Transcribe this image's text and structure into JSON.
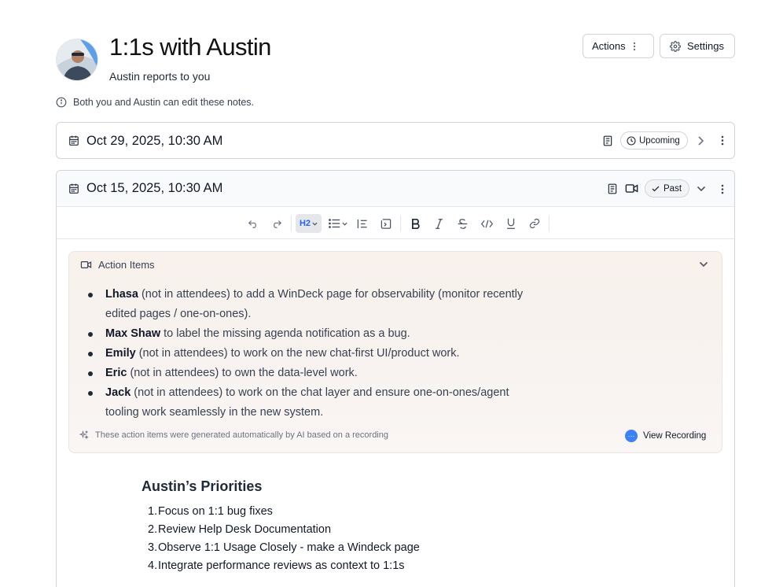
{
  "header": {
    "title": "1:1s with Austin",
    "subtitle": "Austin reports to you",
    "actions_label": "Actions",
    "settings_label": "Settings"
  },
  "info": {
    "text": "Both you and Austin can edit these notes."
  },
  "meetings": [
    {
      "date": "Oct 29, 2025, 10:30 AM",
      "status": "Upcoming"
    },
    {
      "date": "Oct 15, 2025, 10:30 AM",
      "status": "Past"
    }
  ],
  "toolbar": {
    "icons": [
      "undo-icon",
      "redo-icon",
      "heading-icon",
      "list-icon",
      "indent-icon",
      "block-icon",
      "bold-icon",
      "italic-icon",
      "strikethrough-icon",
      "code-icon",
      "underline-icon",
      "link-icon"
    ],
    "heading_label": "H2"
  },
  "action_items": {
    "title": "Action Items",
    "items": [
      {
        "name": "Lhasa",
        "text": " (not in attendees) to add a WinDeck page for observability (monitor recently edited pages / one-on-ones)."
      },
      {
        "name": "Max Shaw",
        "text": " to label the missing agenda notification as a bug."
      },
      {
        "name": "Emily",
        "text": " (not in attendees) to work on the new chat-first UI/product work."
      },
      {
        "name": "Eric",
        "text": " (not in attendees) to own the data-level work."
      },
      {
        "name": "Jack",
        "text": " (not in attendees) to work on the chat layer and ensure one-on-ones/agent tooling work seamlessly in the new system."
      }
    ],
    "footer": "These action items were generated automatically by AI based on a recording",
    "view_recording": "View Recording"
  },
  "priorities": {
    "title": "Austin’s Priorities",
    "items": [
      {
        "num": "1.",
        "text": "Focus on 1:1 bug fixes"
      },
      {
        "num": "2.",
        "text": "Review Help Desk Documentation"
      },
      {
        "num": "3.",
        "text": "Observe 1:1 Usage Closely - make a Windeck page"
      },
      {
        "num": "4.",
        "text": "Integrate performance reviews as context to 1:1s"
      }
    ]
  },
  "colors": {
    "accent": "#3b82f6",
    "ai_box_bg": "#f8f1ec",
    "heading_active": "#2563eb"
  }
}
